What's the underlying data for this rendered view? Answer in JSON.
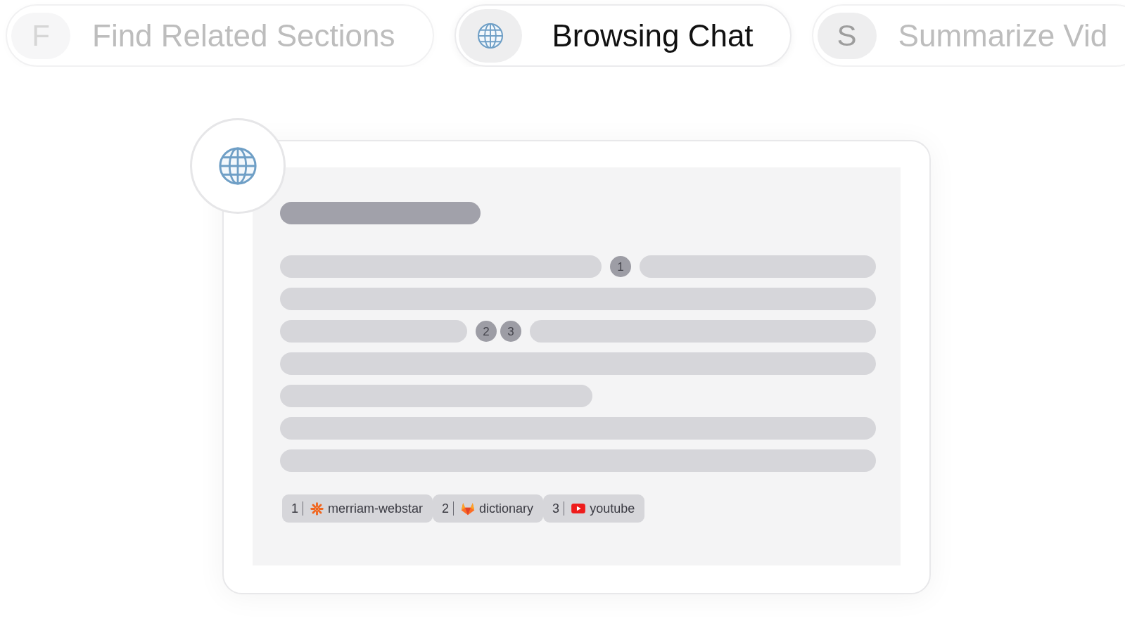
{
  "tabs": [
    {
      "label": "Find Related Sections",
      "badge": "F",
      "selected": false
    },
    {
      "label": "Browsing Chat",
      "selected": true
    },
    {
      "label": "Summarize Vid",
      "badge": "S",
      "selected": false
    }
  ],
  "preview": {
    "citation_groups": [
      {
        "markers": [
          "1"
        ]
      },
      {
        "markers": [
          "2",
          "3"
        ]
      }
    ],
    "sources": [
      {
        "number": "1",
        "name": "merriam-webstar"
      },
      {
        "number": "2",
        "name": "dictionary"
      },
      {
        "number": "3",
        "name": "youtube"
      }
    ]
  }
}
